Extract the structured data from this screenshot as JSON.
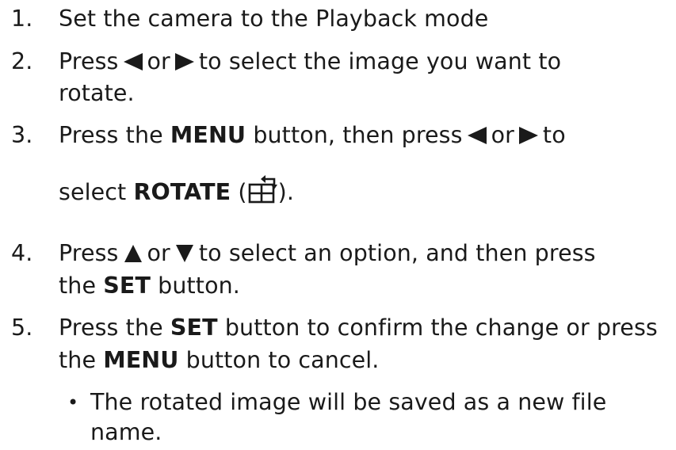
{
  "steps": [
    {
      "num": "1.",
      "line1": "Set the camera to the Playback mode"
    },
    {
      "num": "2.",
      "press": "Press",
      "or": "or",
      "rest": "to select the image you want to",
      "line2": "rotate."
    },
    {
      "num": "3.",
      "press_the": "Press the",
      "menu": "MENU",
      "mid": "button, then press",
      "or": "or",
      "to": "to",
      "select": "select",
      "rotate": "ROTATE",
      "open_paren": "(",
      "close": ")."
    },
    {
      "num": "4.",
      "press": "Press",
      "or": "or",
      "rest": "to select an option, and then press",
      "the": "the",
      "set": "SET",
      "button": "button."
    },
    {
      "num": "5.",
      "press_the": "Press the",
      "set": "SET",
      "mid": "button to confirm the change or press",
      "the": "the",
      "menu": "MENU",
      "end": "button to cancel."
    }
  ],
  "bullet": {
    "symbol": "•",
    "line1": "The rotated image will be saved as a new file",
    "line2": "name."
  },
  "icons": {
    "left": "left-triangle-icon",
    "right": "right-triangle-icon",
    "up": "up-triangle-icon",
    "down": "down-triangle-icon",
    "rotate": "rotate-icon"
  },
  "colors": {
    "text": "#1a1a1a"
  }
}
